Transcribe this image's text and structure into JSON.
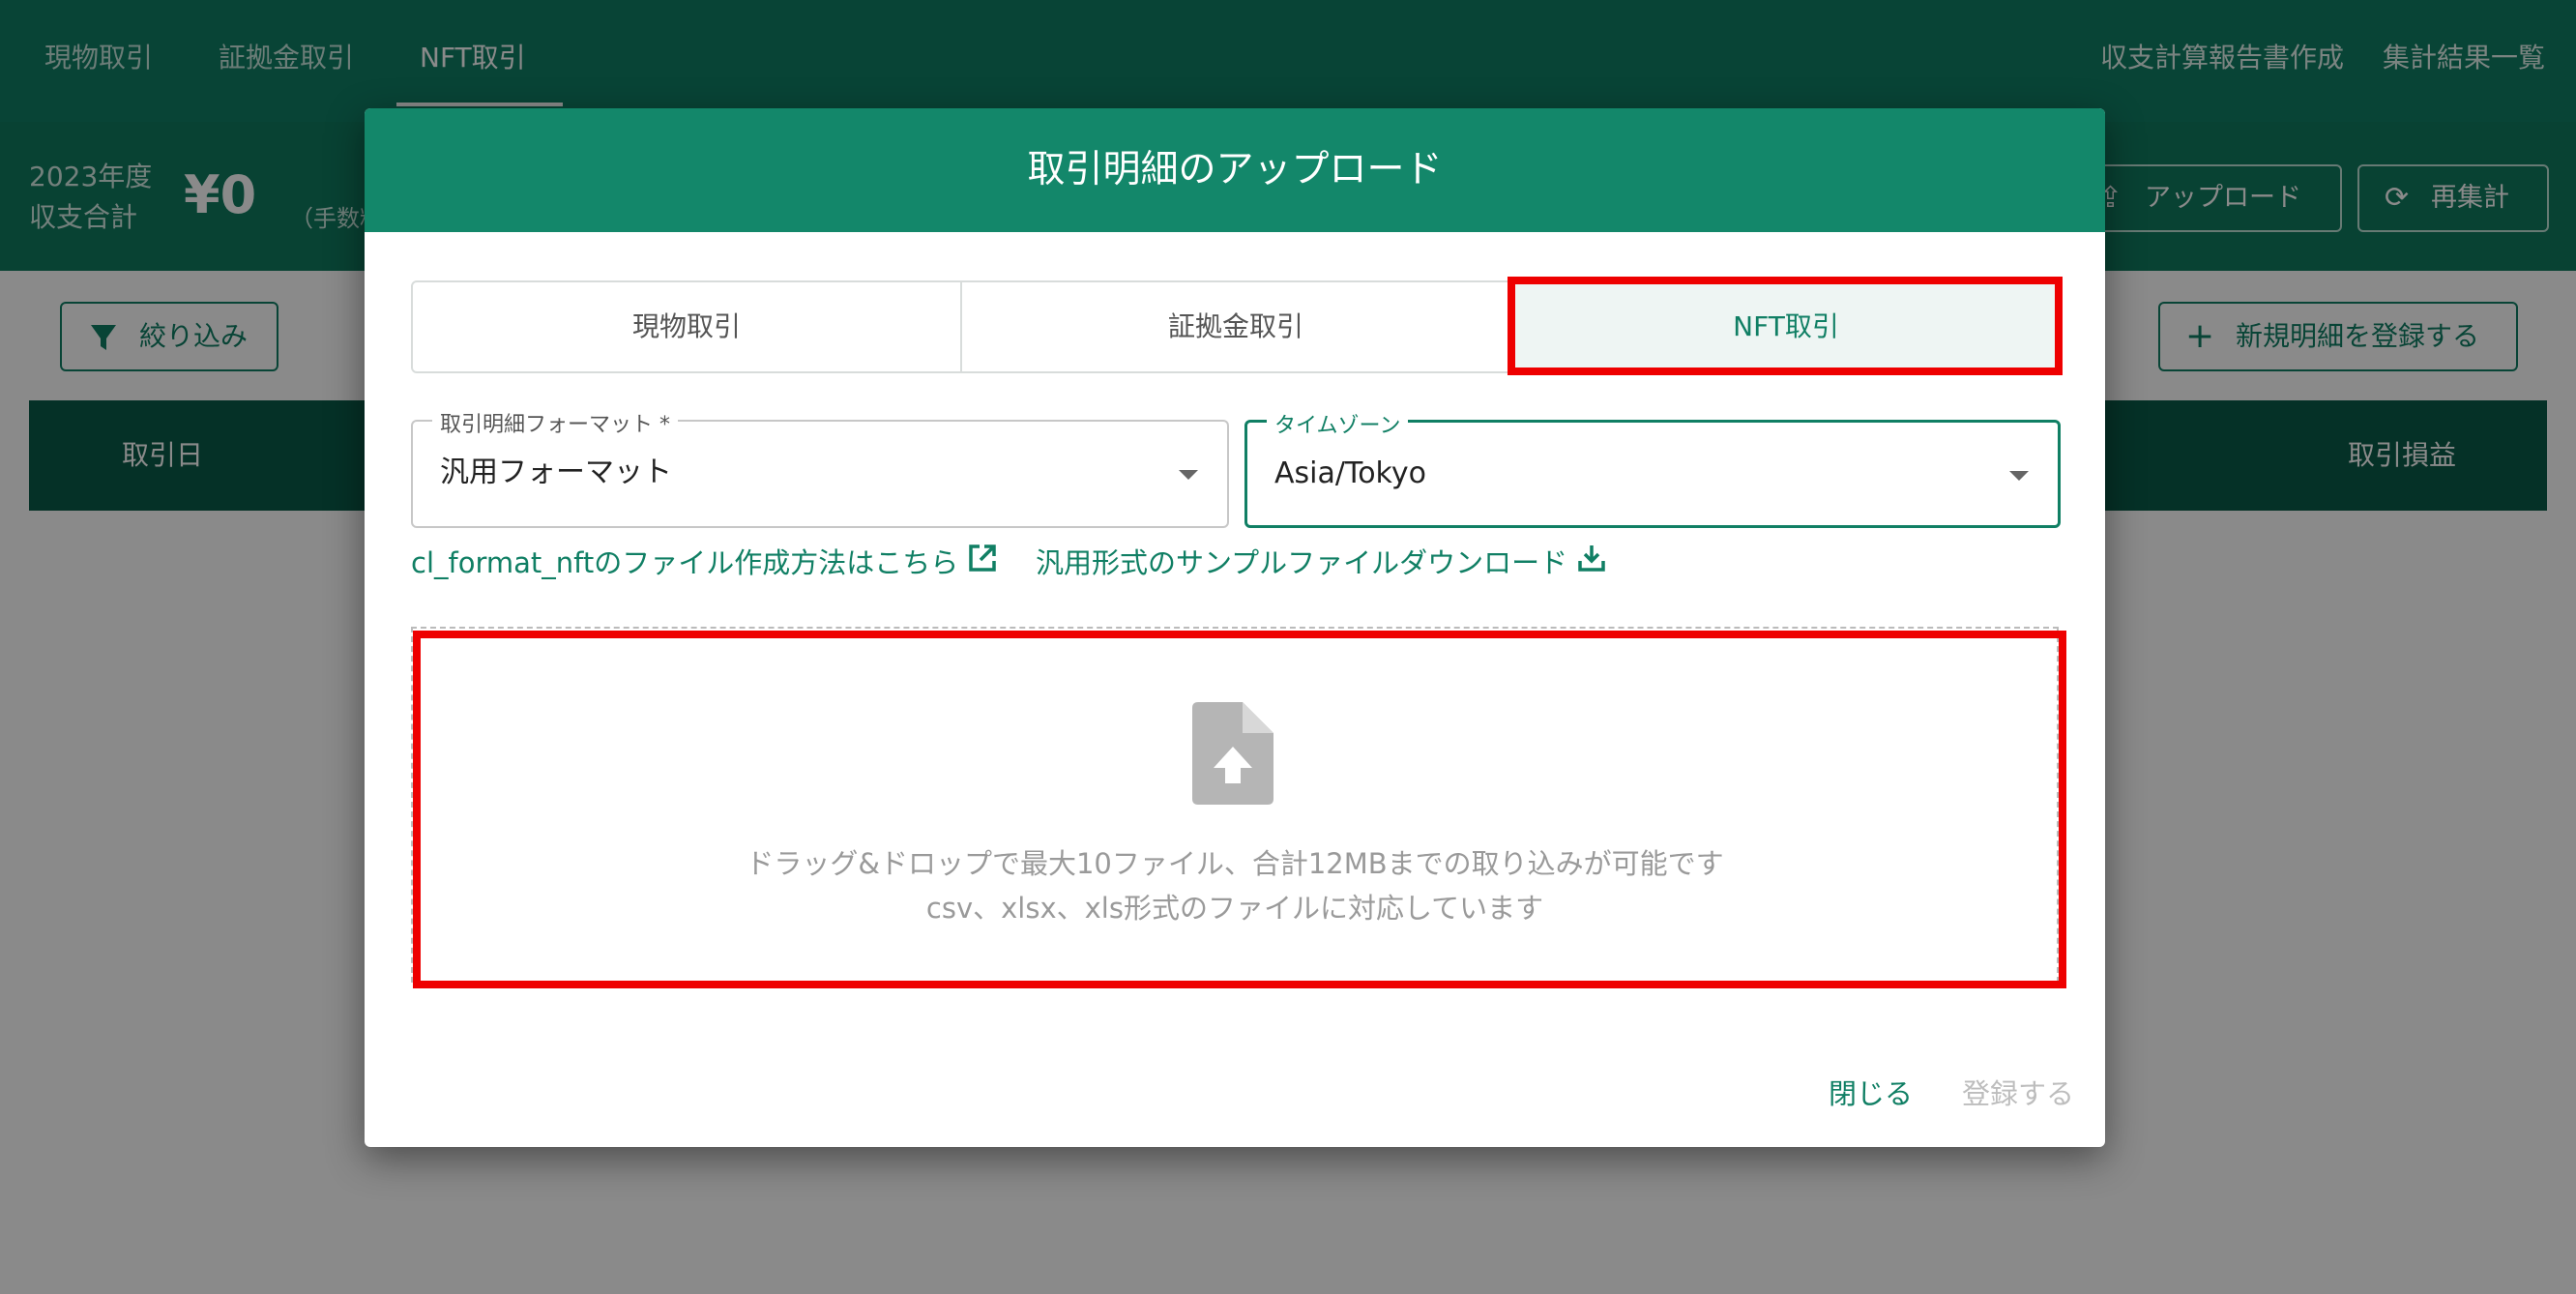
{
  "nav": {
    "tabs": [
      {
        "label": "現物取引"
      },
      {
        "label": "証拠金取引"
      },
      {
        "label": "NFT取引"
      }
    ],
    "right_links": [
      {
        "label": "収支計算報告書作成"
      },
      {
        "label": "集計結果一覧"
      }
    ]
  },
  "summary": {
    "year_label": "2023年度",
    "total_label": "収支合計",
    "amount": "¥0",
    "note": "（手数料",
    "upload_label": "アップロード",
    "recalc_label": "再集計"
  },
  "toolbar": {
    "filter_label": "絞り込み",
    "new_label": "新規明細を登録する"
  },
  "table": {
    "headers": [
      {
        "label": "取引日"
      },
      {
        "label": "取引損益"
      }
    ]
  },
  "modal": {
    "title": "取引明細のアップロード",
    "segments": [
      {
        "label": "現物取引"
      },
      {
        "label": "証拠金取引"
      },
      {
        "label": "NFT取引"
      }
    ],
    "selected_segment": "NFT取引",
    "format_field": {
      "label": "取引明細フォーマット *",
      "value": "汎用フォーマット"
    },
    "timezone_field": {
      "label": "タイムゾーン",
      "value": "Asia/Tokyo"
    },
    "links": {
      "format_help": "cl_format_nftのファイル作成方法はこちら",
      "sample_download": "汎用形式のサンプルファイルダウンロード"
    },
    "dropzone": {
      "line1": "ドラッグ&ドロップで最大10ファイル、合計12MBまでの取り込みが可能です",
      "line2": "csv、xlsx、xls形式のファイルに対応しています"
    },
    "close_label": "閉じる",
    "register_label": "登録する"
  },
  "colors": {
    "brand": "#107f64",
    "header": "#13876a",
    "highlight": "#ee0000",
    "disabled": "#bdbdbd"
  }
}
